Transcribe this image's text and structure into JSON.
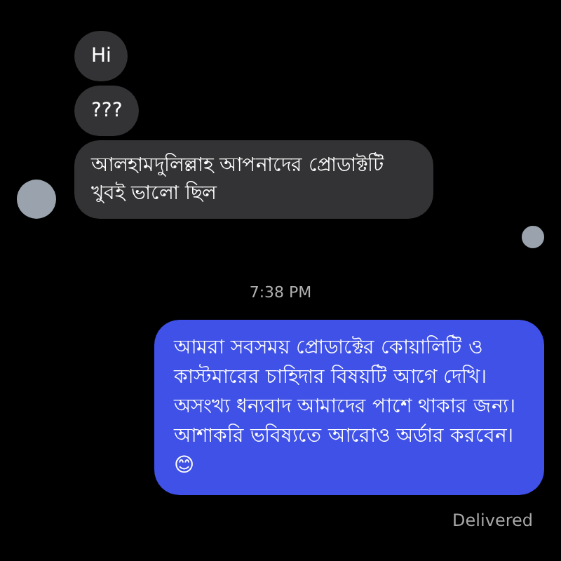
{
  "messages": [
    {
      "kind": "incoming",
      "text": "Hi",
      "avatar": false
    },
    {
      "kind": "incoming",
      "text": "???",
      "avatar": false
    },
    {
      "kind": "incoming",
      "text": "আলহামদুলিল্লাহ আপনাদের প্রোডাক্টটি খুবই ভালো ছিল",
      "avatar": true
    },
    {
      "kind": "seen"
    },
    {
      "kind": "timestamp",
      "text": "7:38 PM"
    },
    {
      "kind": "outgoing",
      "text": "আমরা সবসময় প্রোডাক্টের কোয়ালিটি ও কাস্টমারের চাহিদার বিষয়টি আগে দেখি। অসংখ্য ধন্যবাদ আমাদের পাশে থাকার জন্য।\nআশাকরি ভবিষ্যতে আরোও অর্ডার করবেন।😊"
    },
    {
      "kind": "status",
      "text": "Delivered"
    }
  ]
}
